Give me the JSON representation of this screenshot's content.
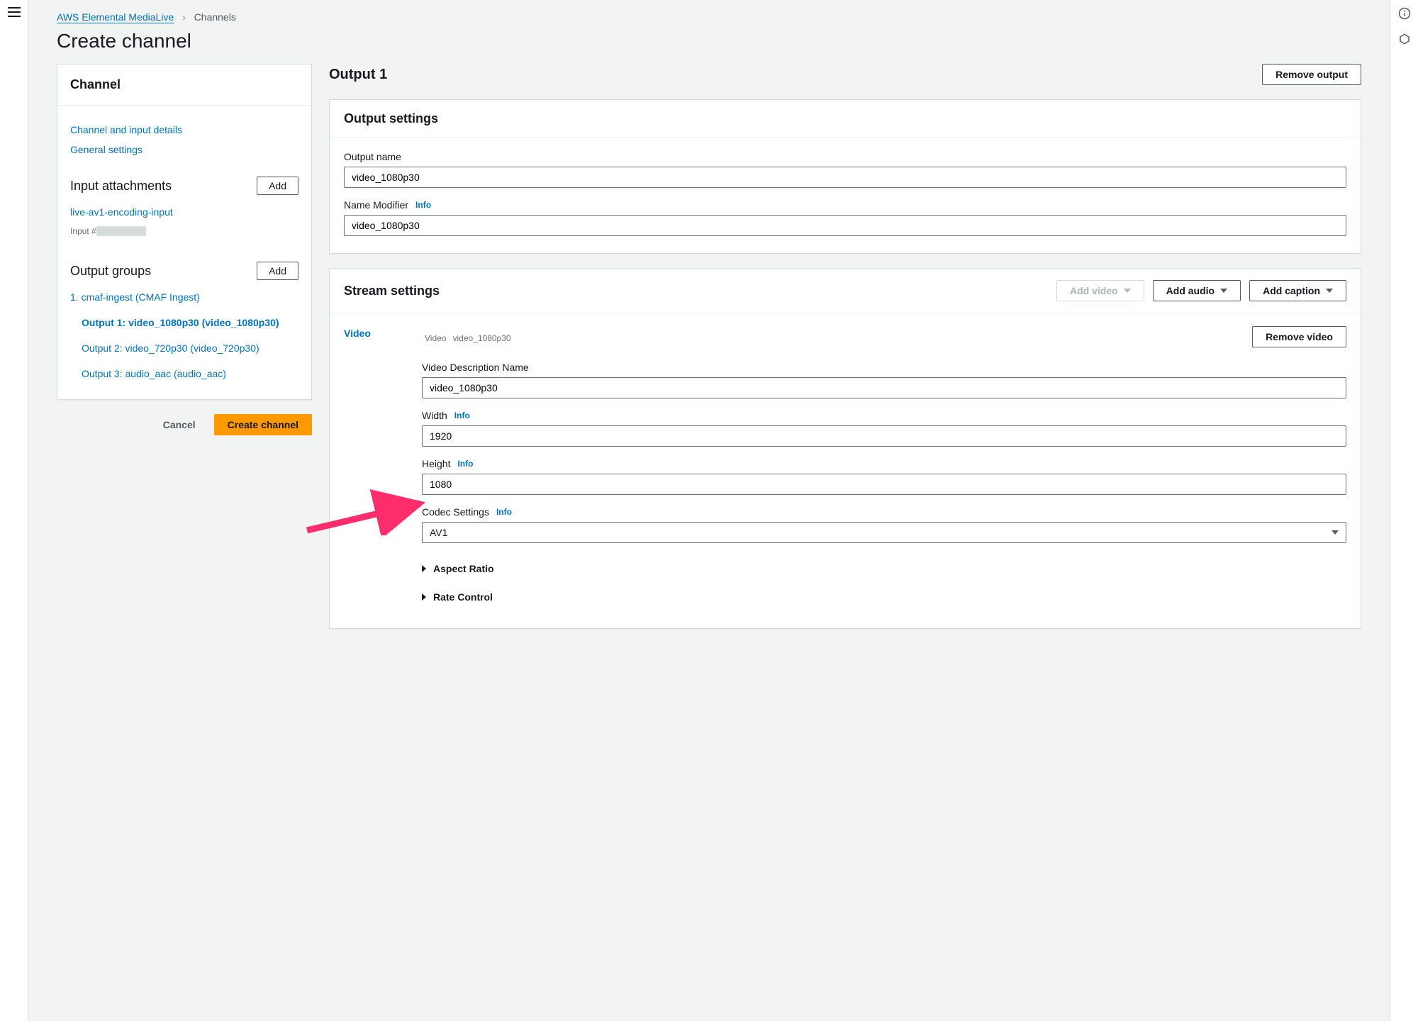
{
  "breadcrumb": {
    "service": "AWS Elemental MediaLive",
    "page": "Channels"
  },
  "page_title": "Create channel",
  "sidebar": {
    "heading": "Channel",
    "nav_links": [
      "Channel and input details",
      "General settings"
    ],
    "input_attachments": {
      "title": "Input attachments",
      "add": "Add",
      "item": "live-av1-encoding-input",
      "sub_prefix": "Input #"
    },
    "output_groups": {
      "title": "Output groups",
      "add": "Add",
      "group": "1. cmaf-ingest (CMAF Ingest)",
      "outputs": [
        "Output 1: video_1080p30 (video_1080p30)",
        "Output 2: video_720p30 (video_720p30)",
        "Output 3: audio_aac (audio_aac)"
      ]
    }
  },
  "footer": {
    "cancel": "Cancel",
    "create": "Create channel"
  },
  "output": {
    "title": "Output 1",
    "remove": "Remove output",
    "settings_heading": "Output settings",
    "name_label": "Output name",
    "name_value": "video_1080p30",
    "modifier_label": "Name Modifier",
    "modifier_value": "video_1080p30"
  },
  "stream": {
    "heading": "Stream settings",
    "add_video": "Add video",
    "add_audio": "Add audio",
    "add_caption": "Add caption",
    "side_tab": "Video",
    "sub_title": "Video",
    "sub_badge": "video_1080p30",
    "remove_video": "Remove video",
    "desc_label": "Video Description Name",
    "desc_value": "video_1080p30",
    "width_label": "Width",
    "width_value": "1920",
    "height_label": "Height",
    "height_value": "1080",
    "codec_label": "Codec Settings",
    "codec_value": "AV1",
    "expanders": [
      "Aspect Ratio",
      "Rate Control"
    ],
    "info": "Info"
  }
}
